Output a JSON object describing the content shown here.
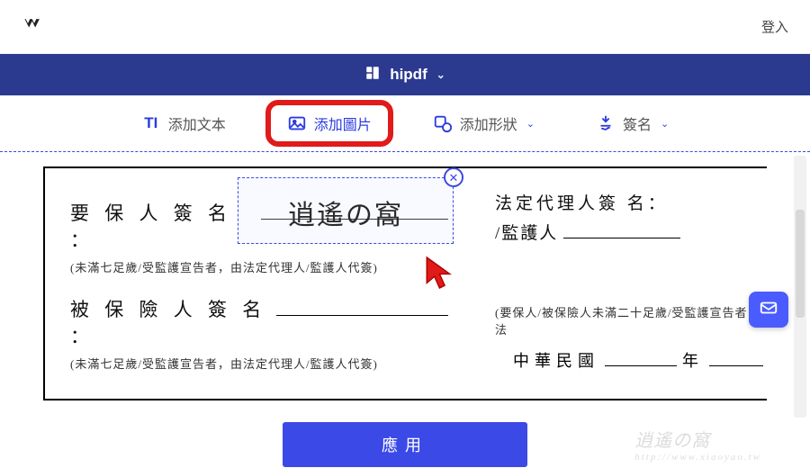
{
  "header": {
    "login": "登入"
  },
  "brand": {
    "name": "hipdf"
  },
  "toolbar": {
    "text_prefix": "TI",
    "text_label": "添加文本",
    "image_label": "添加圖片",
    "shape_label": "添加形狀",
    "sign_label": "簽名"
  },
  "document": {
    "left": {
      "label1": "要 保 人 簽 名 ：",
      "note1": "(未滿七足歲/受監護宣告者，由法定代理人/監護人代簽)",
      "label2": "被 保 險 人 簽 名 ：",
      "note2": "(未滿七足歲/受監護宣告者，由法定代理人/監護人代簽)"
    },
    "right": {
      "label1": "法定代理人簽 名：",
      "label2": "/監護人",
      "footer": "(要保人/被保險人未滿二十足歲/受監護宣告者，法",
      "date_prefix": "中華民國",
      "date_year": "年"
    }
  },
  "selection": {
    "inserted_text": "逍遙の窩"
  },
  "apply": {
    "label": "應用"
  },
  "watermark": {
    "main": "逍遙の窩",
    "sub": "http://www.xiaoyao.tw"
  }
}
